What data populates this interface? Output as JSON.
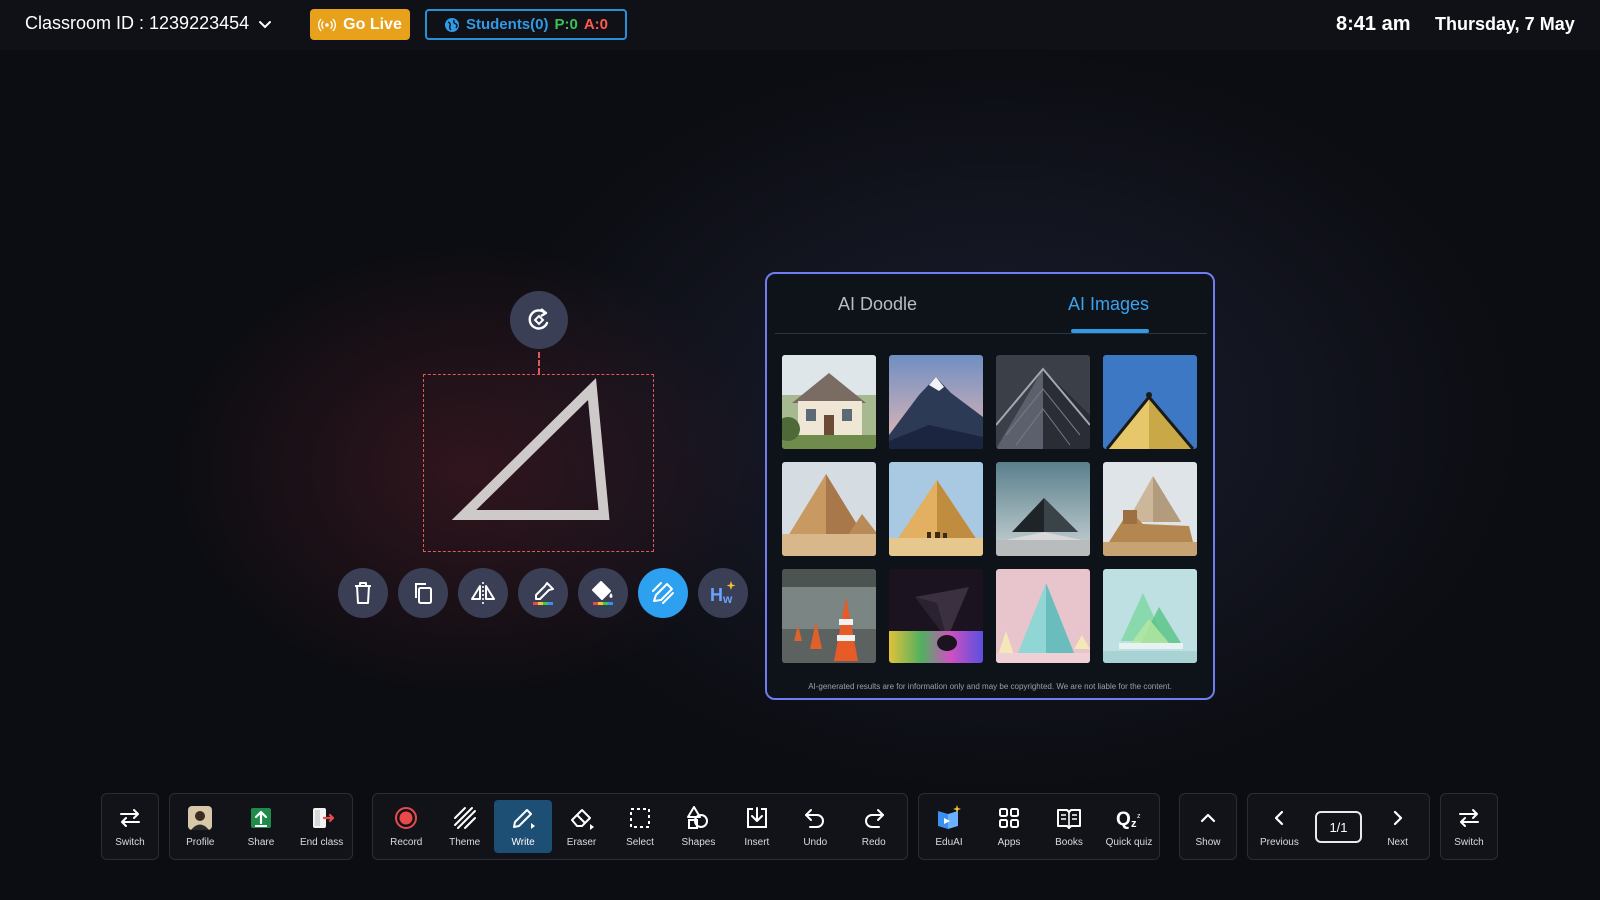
{
  "header": {
    "classroom_label": "Classroom ID : 1239223454",
    "go_live_label": "Go Live",
    "students_label": "Students(0)",
    "present_label": "P:0",
    "absent_label": "A:0",
    "time": "8:41 am",
    "date": "Thursday, 7 May"
  },
  "ai_panel": {
    "tabs": [
      "AI Doodle",
      "AI Images"
    ],
    "active_tab": "AI Images",
    "images": [
      "house",
      "mountain",
      "building-apex",
      "pyramid-roof",
      "desert-pyramids",
      "pyramid-camels",
      "glass-pyramid",
      "sphinx",
      "traffic-cones",
      "colorful-cone",
      "pastel-cones",
      "glass-pyramids"
    ],
    "disclaimer": "AI-generated results are for information only and may be copyrighted. We are not liable for the content."
  },
  "toolbar": {
    "switch_left": "Switch",
    "profile": "Profile",
    "share": "Share",
    "end_class": "End class",
    "record": "Record",
    "theme": "Theme",
    "write": "Write",
    "eraser": "Eraser",
    "select": "Select",
    "shapes": "Shapes",
    "insert": "Insert",
    "undo": "Undo",
    "redo": "Redo",
    "eduai": "EduAI",
    "apps": "Apps",
    "books": "Books",
    "quick_quiz": "Quick quiz",
    "show": "Show",
    "previous": "Previous",
    "page": "1/1",
    "next": "Next",
    "switch_right": "Switch"
  },
  "colors": {
    "go_live": "#e8a11a",
    "accent_blue": "#2f9be6",
    "present_green": "#39c15a",
    "absent_red": "#ff5a4e",
    "selection_red": "#e0585a",
    "panel_border": "#6f7df0"
  }
}
